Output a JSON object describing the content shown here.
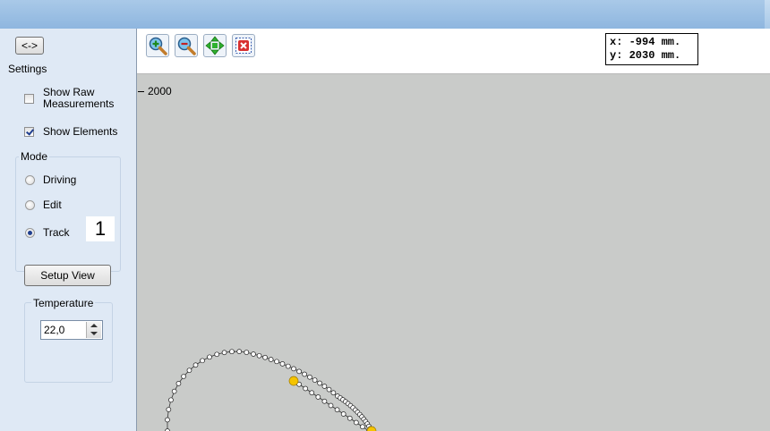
{
  "sidebar": {
    "toggle_label": "<->",
    "settings_label": "Settings",
    "show_raw_label_line1": "Show Raw",
    "show_raw_label_line2": "Measurements",
    "show_raw_checked": false,
    "show_elements_label": "Show Elements",
    "show_elements_checked": true,
    "mode_label": "Mode",
    "modes": [
      "Driving",
      "Edit",
      "Track"
    ],
    "selected_mode": "Track",
    "callout": "1",
    "setup_view_label": "Setup View",
    "temperature_label": "Temperature",
    "temperature_value": "22,0"
  },
  "toolbar": {
    "icons": [
      "zoom-in-icon",
      "zoom-out-icon",
      "pan-icon",
      "reset-icon"
    ]
  },
  "coords": {
    "x_text": "x: -994 mm.",
    "y_text": "y: 2030 mm."
  },
  "canvas": {
    "axis_tick_label": "2000"
  },
  "colors": {
    "canvas_bg": "#c9cbc9",
    "track_point": "#ffffff",
    "highlight_point": "#f5c400"
  }
}
